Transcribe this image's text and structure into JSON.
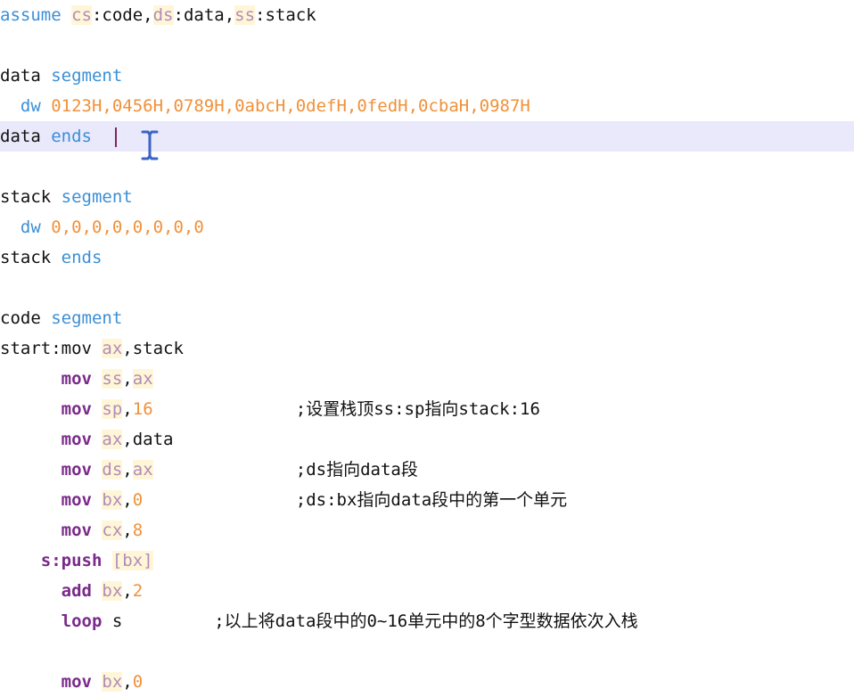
{
  "editor": {
    "lines": [
      {
        "segments": [
          {
            "t": "assume ",
            "c": "kw"
          },
          {
            "t": "cs",
            "c": "reg"
          },
          {
            "t": ":code,",
            "c": "plain"
          },
          {
            "t": "ds",
            "c": "reg"
          },
          {
            "t": ":data,",
            "c": "plain"
          },
          {
            "t": "ss",
            "c": "reg"
          },
          {
            "t": ":stack",
            "c": "plain"
          }
        ]
      },
      {
        "segments": []
      },
      {
        "segments": [
          {
            "t": "data ",
            "c": "plain"
          },
          {
            "t": "segment",
            "c": "kw"
          }
        ]
      },
      {
        "segments": [
          {
            "t": "  dw ",
            "c": "kw"
          },
          {
            "t": "0123H,0456H,0789H,0abcH,0defH,0fedH,0cbaH,0987H",
            "c": "num"
          }
        ]
      },
      {
        "segments": [
          {
            "t": "data ",
            "c": "plain"
          },
          {
            "t": "ends",
            "c": "kw"
          }
        ],
        "current": true
      },
      {
        "segments": []
      },
      {
        "segments": [
          {
            "t": "stack ",
            "c": "plain"
          },
          {
            "t": "segment",
            "c": "kw"
          }
        ]
      },
      {
        "segments": [
          {
            "t": "  dw ",
            "c": "kw"
          },
          {
            "t": "0,0,0,0,0,0,0,0",
            "c": "num"
          }
        ]
      },
      {
        "segments": [
          {
            "t": "stack ",
            "c": "plain"
          },
          {
            "t": "ends",
            "c": "kw"
          }
        ]
      },
      {
        "segments": []
      },
      {
        "segments": [
          {
            "t": "code ",
            "c": "plain"
          },
          {
            "t": "segment",
            "c": "kw"
          }
        ]
      },
      {
        "segments": [
          {
            "t": "start:mov ",
            "c": "plain"
          },
          {
            "t": "ax",
            "c": "reg"
          },
          {
            "t": ",stack",
            "c": "plain"
          }
        ]
      },
      {
        "segments": [
          {
            "t": "      ",
            "c": "plain"
          },
          {
            "t": "mov ",
            "c": "instr"
          },
          {
            "t": "ss",
            "c": "reg"
          },
          {
            "t": ",",
            "c": "plain"
          },
          {
            "t": "ax",
            "c": "reg"
          }
        ]
      },
      {
        "segments": [
          {
            "t": "      ",
            "c": "plain"
          },
          {
            "t": "mov ",
            "c": "instr"
          },
          {
            "t": "sp",
            "c": "reg"
          },
          {
            "t": ",",
            "c": "plain"
          },
          {
            "t": "16",
            "c": "num"
          },
          {
            "t": "              ;设置栈顶ss:sp指向stack:16",
            "c": "comment"
          }
        ]
      },
      {
        "segments": [
          {
            "t": "      ",
            "c": "plain"
          },
          {
            "t": "mov ",
            "c": "instr"
          },
          {
            "t": "ax",
            "c": "reg"
          },
          {
            "t": ",data",
            "c": "plain"
          }
        ]
      },
      {
        "segments": [
          {
            "t": "      ",
            "c": "plain"
          },
          {
            "t": "mov ",
            "c": "instr"
          },
          {
            "t": "ds",
            "c": "reg"
          },
          {
            "t": ",",
            "c": "plain"
          },
          {
            "t": "ax",
            "c": "reg"
          },
          {
            "t": "              ;ds指向data段",
            "c": "comment"
          }
        ]
      },
      {
        "segments": [
          {
            "t": "      ",
            "c": "plain"
          },
          {
            "t": "mov ",
            "c": "instr"
          },
          {
            "t": "bx",
            "c": "reg"
          },
          {
            "t": ",",
            "c": "plain"
          },
          {
            "t": "0",
            "c": "num"
          },
          {
            "t": "               ;ds:bx指向data段中的第一个单元",
            "c": "comment"
          }
        ]
      },
      {
        "segments": [
          {
            "t": "      ",
            "c": "plain"
          },
          {
            "t": "mov ",
            "c": "instr"
          },
          {
            "t": "cx",
            "c": "reg"
          },
          {
            "t": ",",
            "c": "plain"
          },
          {
            "t": "8",
            "c": "num"
          }
        ]
      },
      {
        "segments": [
          {
            "t": "    s:push ",
            "c": "instr"
          },
          {
            "t": "[bx]",
            "c": "reg"
          }
        ]
      },
      {
        "segments": [
          {
            "t": "      ",
            "c": "plain"
          },
          {
            "t": "add ",
            "c": "instr"
          },
          {
            "t": "bx",
            "c": "reg"
          },
          {
            "t": ",",
            "c": "plain"
          },
          {
            "t": "2",
            "c": "num"
          }
        ]
      },
      {
        "segments": [
          {
            "t": "      ",
            "c": "plain"
          },
          {
            "t": "loop ",
            "c": "instr"
          },
          {
            "t": "s",
            "c": "plain"
          },
          {
            "t": "         ;以上将data段中的0~16单元中的8个字型数据依次入栈",
            "c": "comment"
          }
        ]
      },
      {
        "segments": []
      },
      {
        "segments": [
          {
            "t": "      ",
            "c": "plain"
          },
          {
            "t": "mov ",
            "c": "instr"
          },
          {
            "t": "bx",
            "c": "reg"
          },
          {
            "t": ",",
            "c": "plain"
          },
          {
            "t": "0",
            "c": "num"
          }
        ]
      }
    ]
  },
  "colors": {
    "keyword": "#3b8fd6",
    "number": "#f0913a",
    "register": "#b28cb6",
    "register_highlight": "#fff6d8",
    "instruction": "#7a2a8a",
    "current_line_bg": "#e9e9fb",
    "caret": "#7b2a5a"
  },
  "icons": {
    "cursor": "ibeam-cursor-icon"
  }
}
